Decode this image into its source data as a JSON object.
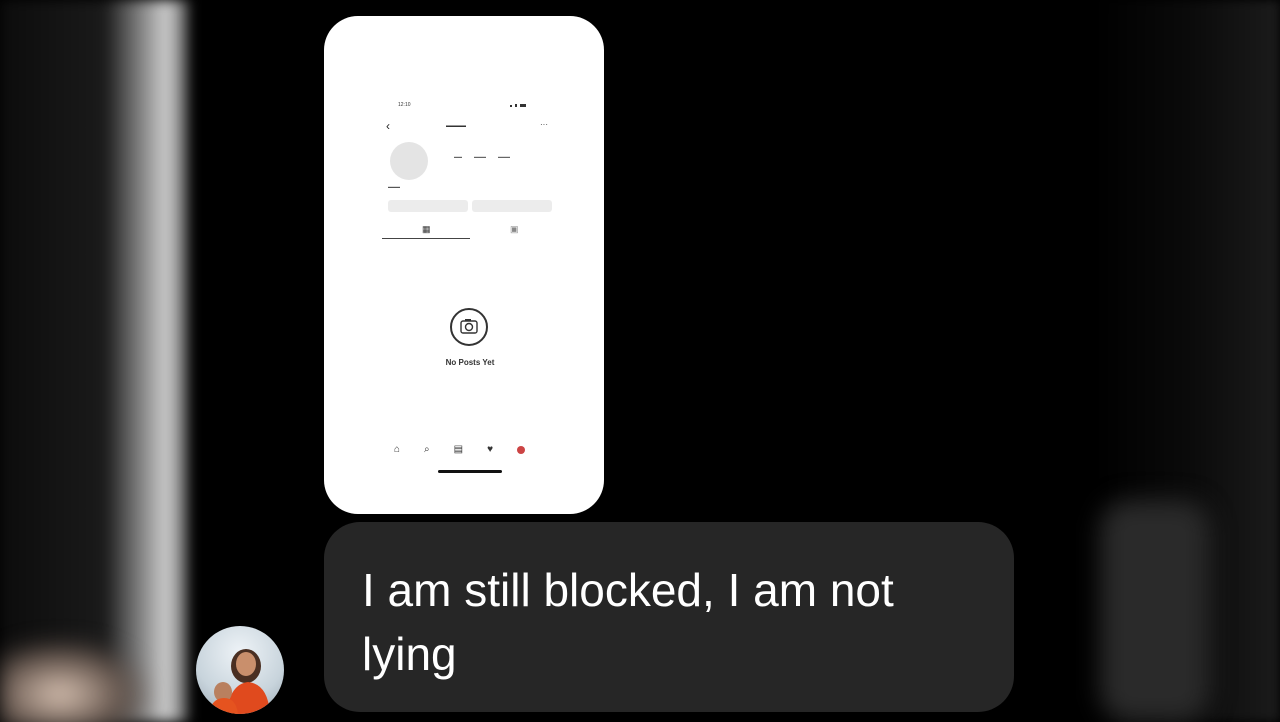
{
  "message": {
    "text": "I am still blocked, I am not lying"
  },
  "shared_screenshot": {
    "status_time": "12:10",
    "empty_state_text": "No Posts Yet"
  },
  "colors": {
    "background": "#000000",
    "bubble": "#262626",
    "bubble_text": "#ffffff",
    "card": "#ffffff"
  },
  "icons": {
    "avatar": "sender-avatar",
    "camera": "camera-icon"
  }
}
